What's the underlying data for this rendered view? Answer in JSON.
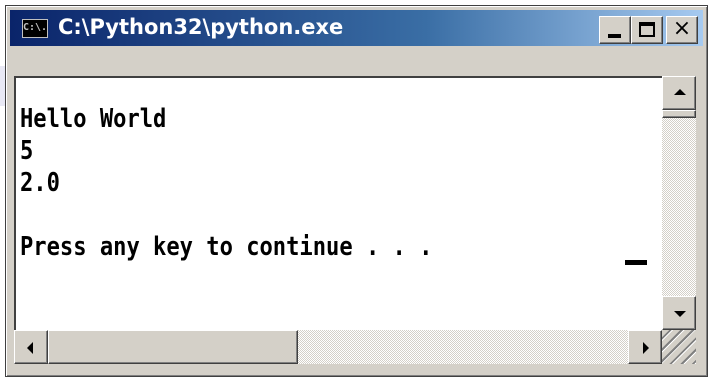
{
  "window": {
    "title": "C:\\Python32\\python.exe",
    "icon": "console-app-icon",
    "icon_text": "C:\\.",
    "controls": {
      "minimize": "minimize-button",
      "maximize": "maximize-button",
      "close_label": "×"
    }
  },
  "console": {
    "lines": [
      "Hello World",
      "5",
      "2.0",
      "",
      "Press any key to continue . . ."
    ]
  },
  "colors": {
    "titlebar_start": "#0a246a",
    "titlebar_end": "#a6caf0",
    "console_bg": "#ffffff",
    "console_text": "#000000",
    "chrome": "#d4d0c8"
  }
}
